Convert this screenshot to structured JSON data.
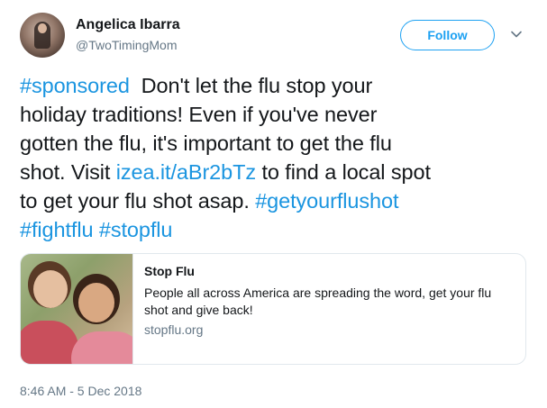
{
  "author": {
    "name": "Angelica Ibarra",
    "handle": "@TwoTimingMom",
    "avatar_icon": "user-avatar"
  },
  "header": {
    "follow_label": "Follow",
    "menu_icon": "chevron-down-icon"
  },
  "tweet": {
    "lines": [
      [
        {
          "text": "#sponsored",
          "link": true
        },
        {
          "text": "  Don't let the flu stop your",
          "link": false
        }
      ],
      [
        {
          "text": "holiday traditions! Even if you've never",
          "link": false
        }
      ],
      [
        {
          "text": "gotten the flu, it's important to get the flu",
          "link": false
        }
      ],
      [
        {
          "text": "shot. Visit ",
          "link": false
        },
        {
          "text": "izea.it/aBr2bTz",
          "link": true
        },
        {
          "text": " to find a local spot",
          "link": false
        }
      ],
      [
        {
          "text": "to get your flu shot asap. ",
          "link": false
        },
        {
          "text": "#getyourflushot",
          "link": true
        }
      ],
      [
        {
          "text": "#fightflu",
          "link": true
        },
        {
          "text": " ",
          "link": false
        },
        {
          "text": "#stopflu",
          "link": true
        }
      ]
    ]
  },
  "card": {
    "title": "Stop Flu",
    "description": "People all across America are spreading the word, get your flu shot and give back!",
    "domain": "stopflu.org"
  },
  "timestamp": "8:46 AM - 5 Dec 2018",
  "colors": {
    "link": "#1b95e0",
    "accent": "#1da1f2",
    "secondary_text": "#657786",
    "border": "#e1e8ed"
  }
}
